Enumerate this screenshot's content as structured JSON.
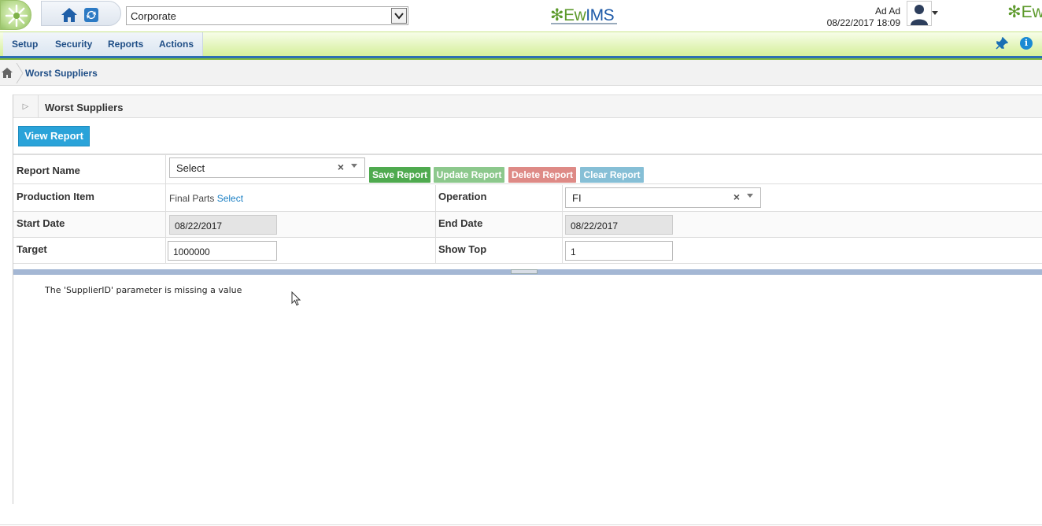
{
  "header": {
    "company_select_value": "Corporate",
    "brand_prefix": "Ew",
    "brand_suffix": "IMS",
    "brand_right": "Ew",
    "user_name": "Ad Ad",
    "user_datetime": "08/22/2017 18:09",
    "icons": {
      "home": "home-icon",
      "refresh": "refresh-icon",
      "avatar": "user-avatar-icon"
    }
  },
  "menu": {
    "items": [
      "Setup",
      "Security",
      "Reports",
      "Actions"
    ],
    "icons": [
      "pin-icon",
      "info-icon"
    ],
    "info_glyph": "i"
  },
  "breadcrumb": {
    "current": "Worst Suppliers"
  },
  "panel": {
    "title": "Worst Suppliers",
    "view_report_label": "View Report"
  },
  "form": {
    "report_name_label": "Report Name",
    "report_name_value": "Select",
    "save_report": "Save Report",
    "update_report": "Update Report",
    "delete_report": "Delete Report",
    "clear_report": "Clear Report",
    "production_item_label": "Production Item",
    "production_item_value": "Final Parts",
    "production_item_link": "Select",
    "operation_label": "Operation",
    "operation_value": "FI",
    "start_date_label": "Start Date",
    "start_date_value": "08/22/2017",
    "end_date_label": "End Date",
    "end_date_value": "08/22/2017",
    "target_label": "Target",
    "target_value": "1000000",
    "show_top_label": "Show Top",
    "show_top_value": "1"
  },
  "report": {
    "message": "The 'SupplierID' parameter is missing a value"
  },
  "colors": {
    "primary_blue": "#2aa3d9",
    "save_green": "#4faa4f",
    "update_green": "#8cc88c",
    "delete_red": "#de8a86",
    "clear_blue": "#86bfd6",
    "nav_text": "#1f4e86"
  }
}
